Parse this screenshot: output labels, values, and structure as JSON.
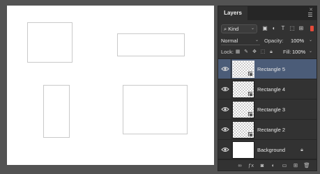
{
  "panel": {
    "tab_label": "Layers",
    "close_glyph": "✕",
    "menu_glyph": "☰",
    "accent_color": "#4b5c78"
  },
  "filter": {
    "kind_label": "Kind",
    "icons": [
      "image-filter-icon",
      "adjustment-filter-icon",
      "type-filter-icon",
      "shape-filter-icon",
      "smart-object-filter-icon"
    ]
  },
  "blend": {
    "mode": "Normal",
    "opacity_label": "Opacity:",
    "opacity_value": "100%"
  },
  "lock": {
    "label": "Lock:",
    "fill_label": "Fill:",
    "fill_value": "100%"
  },
  "layers": [
    {
      "name": "Rectangle 5",
      "selected": true,
      "smart_object": true
    },
    {
      "name": "Rectangle 4",
      "selected": false,
      "smart_object": true
    },
    {
      "name": "Rectangle 3",
      "selected": false,
      "smart_object": true
    },
    {
      "name": "Rectangle 2",
      "selected": false,
      "smart_object": true
    },
    {
      "name": "Background",
      "selected": false,
      "locked": true
    }
  ],
  "footer_icons": [
    "link-icon",
    "fx-icon",
    "mask-icon",
    "adjustment-icon",
    "group-icon",
    "new-layer-icon",
    "delete-icon"
  ]
}
